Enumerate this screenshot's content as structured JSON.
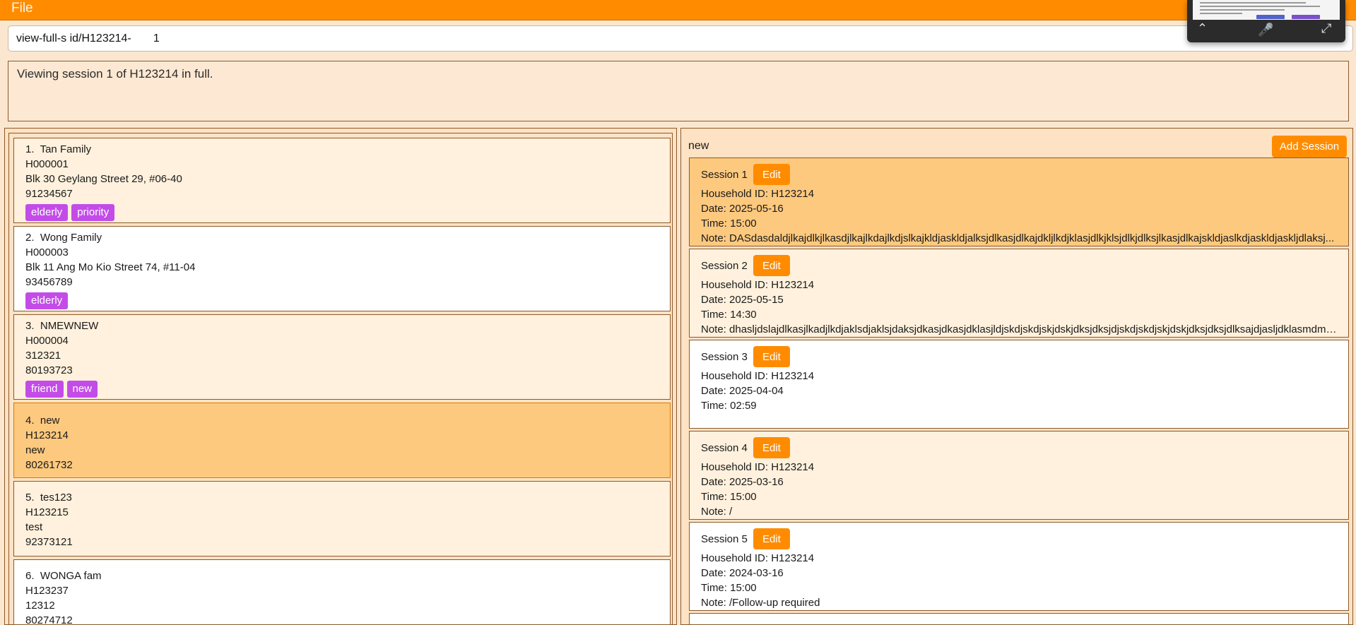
{
  "menubar": {
    "file_label": "File"
  },
  "command": {
    "value": "view-full-s id/H123214-       1"
  },
  "result": {
    "text": "Viewing session 1 of H123214 in full."
  },
  "households": [
    {
      "index": "1.",
      "name": "Tan Family",
      "id": "H000001",
      "address": "Blk 30 Geylang Street 29, #06-40",
      "phone": "91234567",
      "tags": [
        "elderly",
        "priority"
      ]
    },
    {
      "index": "2.",
      "name": "Wong Family",
      "id": "H000003",
      "address": "Blk 11 Ang Mo Kio Street 74, #11-04",
      "phone": "93456789",
      "tags": [
        "elderly"
      ]
    },
    {
      "index": "3.",
      "name": "NMEWNEW",
      "id": "H000004",
      "address": "312321",
      "phone": "80193723",
      "tags": [
        "friend",
        "new"
      ]
    },
    {
      "index": "4.",
      "name": "new",
      "id": "H123214",
      "address": "new",
      "phone": "80261732",
      "tags": []
    },
    {
      "index": "5.",
      "name": "tes123",
      "id": "H123215",
      "address": "test",
      "phone": "92373121",
      "tags": []
    },
    {
      "index": "6.",
      "name": "WONGA fam",
      "id": "H123237",
      "address": "12312",
      "phone": "80274712",
      "tags": []
    }
  ],
  "detail": {
    "household_name": "new",
    "add_session_label": "Add Session",
    "edit_label": "Edit",
    "sessions": [
      {
        "title": "Session 1",
        "household": "Household ID: H123214",
        "date": "Date: 2025-05-16",
        "time": "Time: 15:00",
        "note": "Note: DASdasdaldjlkajdlkjlkasdjlkajlkdajlkdjslkajkldjaskldjalksjdlkasjdlkajdkljlkdjklasjdlkjklsjdlkjdlksjlkasjdlkajskldjaslkdjaskldjaskljdlaksj..."
      },
      {
        "title": "Session 2",
        "household": "Household ID: H123214",
        "date": "Date: 2025-05-15",
        "time": "Time: 14:30",
        "note": "Note: dhasljdslajdlkasjlkadjlkdjaklsdjaklsjdaksjdkasjdkasjdklasjldjskdjskdjskjdskjdksjdksjdjskdjskdjskjdskjdksjdksjdlksajdjasljdklasmdmlkad..."
      },
      {
        "title": "Session 3",
        "household": "Household ID: H123214",
        "date": "Date: 2025-04-04",
        "time": "Time: 02:59",
        "note": ""
      },
      {
        "title": "Session 4",
        "household": "Household ID: H123214",
        "date": "Date: 2025-03-16",
        "time": "Time: 15:00",
        "note": "Note: /"
      },
      {
        "title": "Session 5",
        "household": "Household ID: H123214",
        "date": "Date: 2024-03-16",
        "time": "Time: 15:00",
        "note": "Note: /Follow-up required"
      }
    ]
  },
  "colors": {
    "accent": "#ff8c00",
    "tag": "#c34ce8",
    "selected": "#fdc97e",
    "background": "#fbe7cf"
  },
  "overlay_icons": [
    "chevron-up-icon",
    "microphone-muted-icon",
    "expand-icon"
  ]
}
